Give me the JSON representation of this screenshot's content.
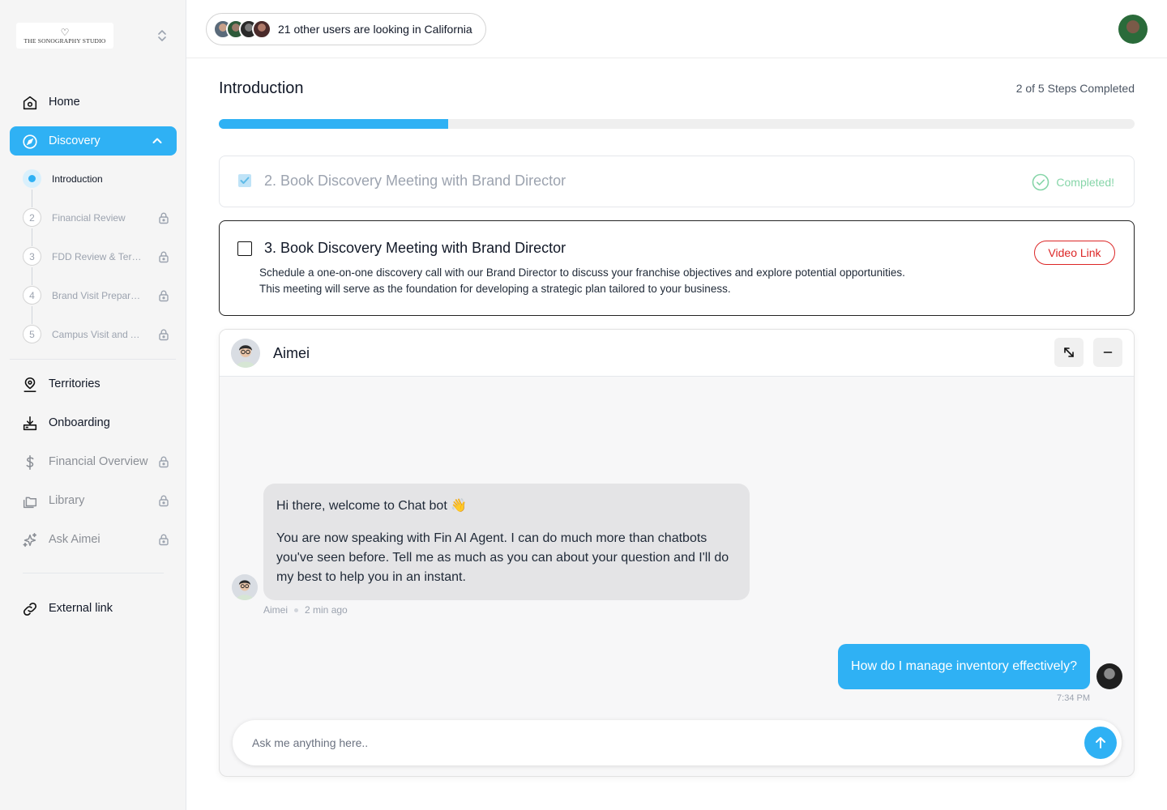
{
  "brand": {
    "name": "THE SONOGRAPHY STUDIO",
    "heart": "♡"
  },
  "sidebar": {
    "nav": [
      {
        "label": "Home",
        "icon": "home-icon",
        "locked": false
      },
      {
        "label": "Discovery",
        "icon": "compass-icon",
        "active": true
      },
      {
        "label": "Territories",
        "icon": "map-pin-user-icon",
        "locked": false
      },
      {
        "label": "Onboarding",
        "icon": "tray-download-icon",
        "locked": false
      },
      {
        "label": "Financial Overview",
        "icon": "dollar-icon",
        "locked": true
      },
      {
        "label": "Library",
        "icon": "folders-icon",
        "locked": true
      },
      {
        "label": "Ask Aimei",
        "icon": "sparkles-icon",
        "locked": true
      },
      {
        "label": "External link",
        "icon": "link-icon",
        "locked": false
      }
    ],
    "substeps": [
      {
        "num": "",
        "label": "Introduction",
        "current": true
      },
      {
        "num": "2",
        "label": "Financial Review",
        "locked": true
      },
      {
        "num": "3",
        "label": "FDD Review & Territory Selection",
        "locked": true
      },
      {
        "num": "4",
        "label": "Brand Visit Preparation",
        "locked": true
      },
      {
        "num": "5",
        "label": "Campus Visit and Approval",
        "locked": true
      }
    ]
  },
  "topbar": {
    "viewers_text": "21 other users are  looking in California"
  },
  "main": {
    "title": "Introduction",
    "steps_completed": "2 of  5 Steps Completed",
    "progress": 0.25,
    "colors": {
      "accent": "#2fb1f4",
      "danger": "#dc2626",
      "success": "#86d5a8"
    },
    "tasks": [
      {
        "title": "2. Book Discovery Meeting with Brand Director",
        "status": "Completed!",
        "done": true
      },
      {
        "title": "3. Book Discovery Meeting with Brand Director",
        "description": "Schedule a one-on-one discovery call with our Brand Director to discuss your franchise objectives and explore potential opportunities. This meeting will serve as the foundation for developing a strategic plan tailored to your business.",
        "action": "Video Link",
        "done": false
      }
    ]
  },
  "chat": {
    "name": "Aimei",
    "bot_message": {
      "greeting": "Hi there, welcome to Chat bot 👋",
      "body": "You are now speaking with Fin AI Agent. I can do much more than chatbots you've seen before. Tell me as much as you can about your question and I'll do my best to help you in an instant.",
      "author": "Aimei",
      "time": "2 min ago"
    },
    "user_message": {
      "text": "How do I manage inventory effectively?",
      "time": "7:34 PM"
    },
    "composer_placeholder": "Ask me anything here.."
  }
}
